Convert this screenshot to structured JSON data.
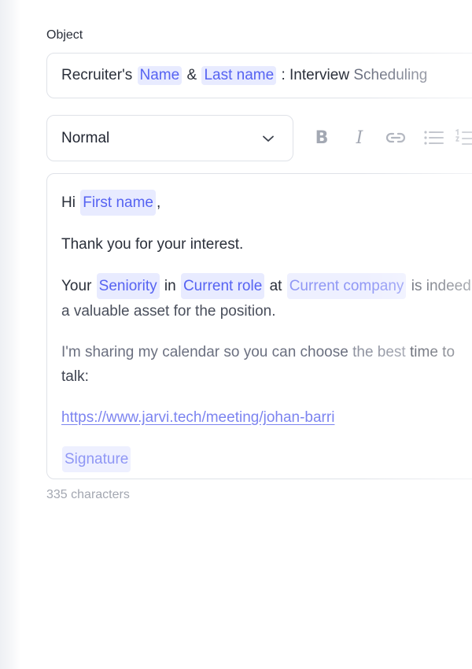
{
  "object": {
    "label": "Object",
    "prefix": "Recruiter's",
    "chip_name": "Name",
    "amp": "&",
    "chip_last_name": "Last name",
    "suffix_dark": ": Interview",
    "suffix_light": "Scheduling"
  },
  "toolbar": {
    "style_value": "Normal",
    "bold_label": "B",
    "italic_label": "I",
    "link_icon": "link-icon",
    "bullet_list_icon": "bullet-list-icon",
    "numbered_list_icon": "numbered-list-icon"
  },
  "editor": {
    "line1_pre": "Hi",
    "line1_chip": "First name",
    "line1_post": ",",
    "line2": "Thank you for your interest.",
    "line3_a": "Your",
    "line3_chip1": "Seniority",
    "line3_b": "in",
    "line3_chip2": "Current role",
    "line3_c": "at",
    "line3_chip3": "Current company",
    "line3_d": "is indeed a valuable asset for the position.",
    "line4_a": "I'm sharing my calendar so you can choose",
    "line4_b": "the best",
    "line4_c": "time to talk:",
    "link": "https://www.jarvi.tech/meeting/johan-barri",
    "signature_chip": "Signature"
  },
  "footer": {
    "char_count": "335 characters"
  },
  "colors": {
    "chip_bg": "#e8ebff",
    "chip_text": "#5663f2",
    "border": "#dfe2e8",
    "link": "#7c84f0"
  }
}
